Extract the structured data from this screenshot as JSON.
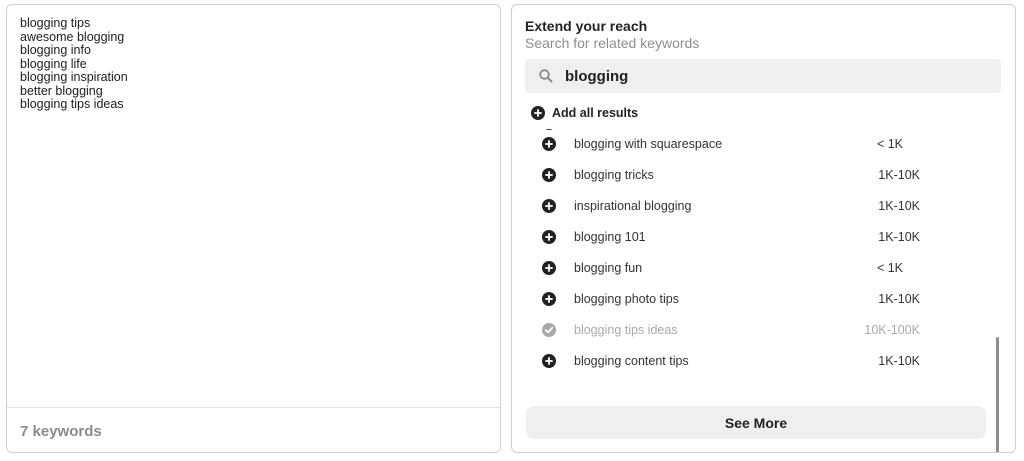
{
  "keywords_panel": {
    "keywords": [
      "blogging tips",
      "awesome blogging",
      "blogging info",
      "blogging life",
      "blogging inspiration",
      "better blogging",
      "blogging tips ideas"
    ],
    "count_label": "7 keywords"
  },
  "reach_panel": {
    "title": "Extend your reach",
    "subtitle": "Search for related keywords",
    "search": {
      "value": "blogging",
      "icon": "search-icon"
    },
    "add_all_label": "Add all results",
    "results": [
      {
        "keyword": "blogging with squarespace",
        "volume": "< 1K",
        "added": false
      },
      {
        "keyword": "blogging tricks",
        "volume": "1K-10K",
        "added": false
      },
      {
        "keyword": "inspirational blogging",
        "volume": "1K-10K",
        "added": false
      },
      {
        "keyword": "blogging 101",
        "volume": "1K-10K",
        "added": false
      },
      {
        "keyword": "blogging fun",
        "volume": "< 1K",
        "added": false
      },
      {
        "keyword": "blogging photo tips",
        "volume": "1K-10K",
        "added": false
      },
      {
        "keyword": "blogging tips ideas",
        "volume": "10K-100K",
        "added": true
      },
      {
        "keyword": "blogging content tips",
        "volume": "1K-10K",
        "added": false
      }
    ],
    "see_more_label": "See More"
  },
  "colors": {
    "accent_dark": "#222222",
    "added_gray": "#a9a9a9",
    "button_bg": "#efefef"
  }
}
